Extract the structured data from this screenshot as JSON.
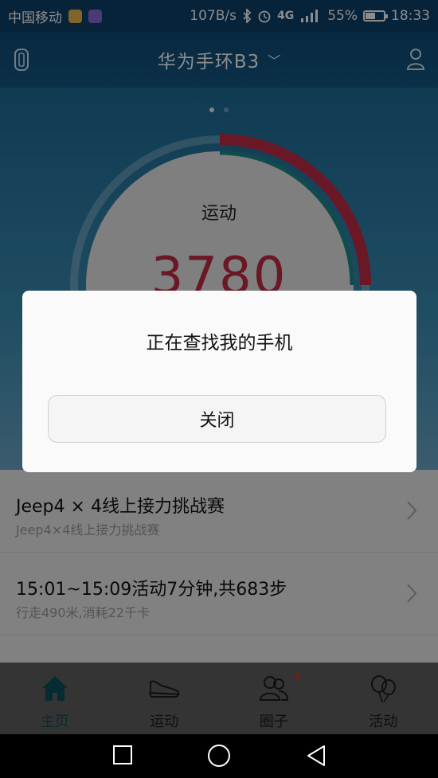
{
  "status_bar": {
    "carrier": "中国移动",
    "speed": "107B/s",
    "network": "4G",
    "battery": "55%",
    "battery_level": 0.55,
    "time": "18:33"
  },
  "header": {
    "title": "华为手环B3",
    "caret": "﹀"
  },
  "hero": {
    "activity_label": "运动",
    "steps": "3780",
    "page_count": 2,
    "active_page": 1
  },
  "dialog": {
    "message": "正在查找我的手机",
    "close_label": "关闭"
  },
  "list": {
    "items": [
      {
        "title": "Jeep4 × 4线上接力挑战赛",
        "subtitle": "Jeep4×4线上接力挑战赛"
      },
      {
        "title": "15:01~15:09活动7分钟,共683步",
        "subtitle": "行走490米,消耗22千卡"
      }
    ]
  },
  "tabs": [
    {
      "label": "主页",
      "icon": "home-icon",
      "active": true
    },
    {
      "label": "运动",
      "icon": "shoe-icon",
      "active": false
    },
    {
      "label": "圈子",
      "icon": "people-icon",
      "active": false
    },
    {
      "label": "活动",
      "icon": "balloon-icon",
      "active": false
    }
  ],
  "colors": {
    "accent": "#c22a45",
    "ring_teal": "#1f8a8a",
    "tab_active": "#0b4f5a"
  }
}
